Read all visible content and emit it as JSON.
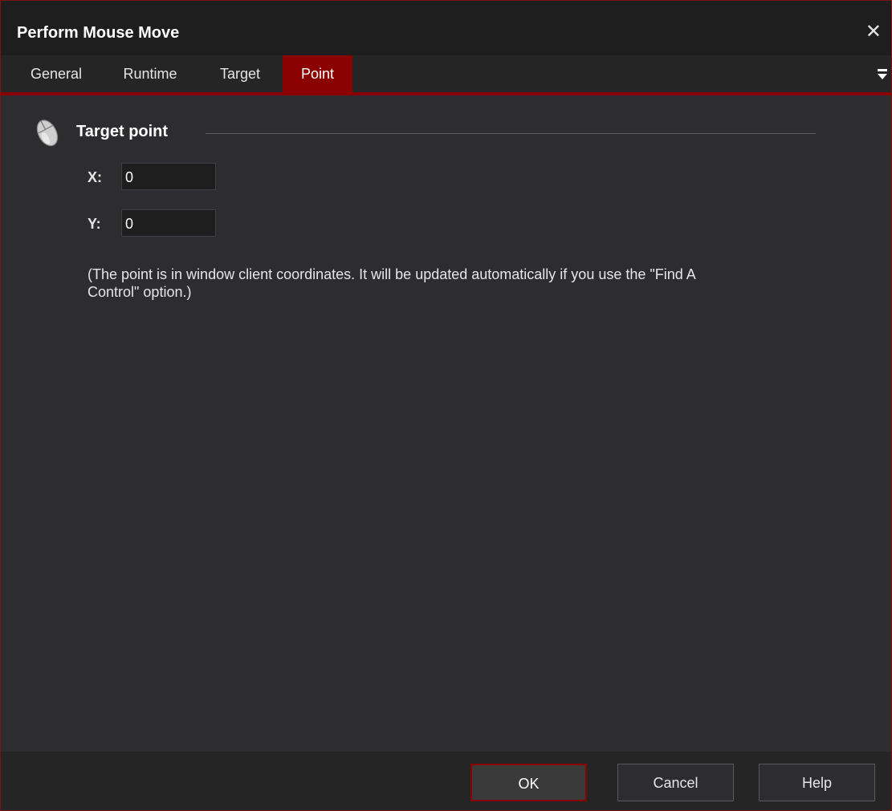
{
  "window": {
    "title": "Perform Mouse Move",
    "close_glyph": "✕"
  },
  "tabs": [
    {
      "label": "General",
      "active": false
    },
    {
      "label": "Runtime",
      "active": false
    },
    {
      "label": "Target",
      "active": false
    },
    {
      "label": "Point",
      "active": true
    }
  ],
  "tab_menu_icon": "dropdown-menu-icon",
  "section": {
    "icon": "mouse-icon",
    "title": "Target point"
  },
  "fields": {
    "x": {
      "label": "X:",
      "value": "0"
    },
    "y": {
      "label": "Y:",
      "value": "0"
    }
  },
  "note": "(The point is in window client coordinates. It will be updated automatically if you use the \"Find A Control\" option.)",
  "buttons": {
    "ok": "OK",
    "cancel": "Cancel",
    "help": "Help"
  },
  "colors": {
    "accent": "#8b0000",
    "background": "#2d2d30",
    "titlebar": "#1e1e1e"
  }
}
